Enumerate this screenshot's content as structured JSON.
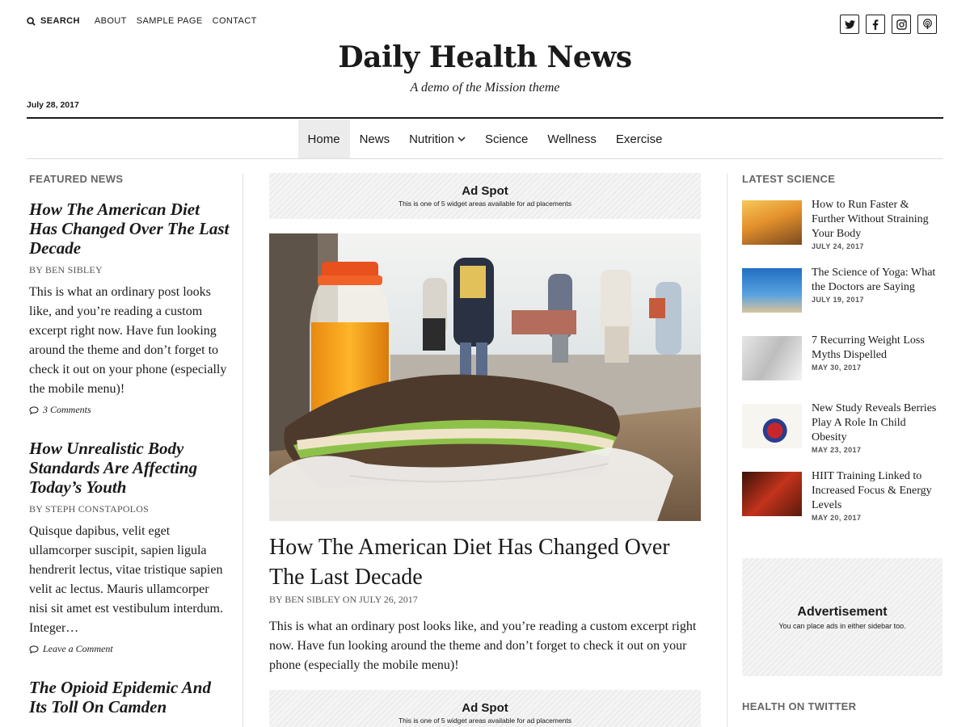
{
  "topbar": {
    "search_label": "SEARCH",
    "links": [
      "ABOUT",
      "SAMPLE PAGE",
      "CONTACT"
    ]
  },
  "social": {
    "twitter": "twitter-icon",
    "facebook": "facebook-icon",
    "instagram": "instagram-icon",
    "podcast": "podcast-icon"
  },
  "header": {
    "title": "Daily Health News",
    "tagline": "A demo of the Mission theme",
    "date": "July 28, 2017"
  },
  "nav": {
    "items": [
      "Home",
      "News",
      "Nutrition",
      "Science",
      "Wellness",
      "Exercise"
    ],
    "active": "Home"
  },
  "featured": {
    "heading": "FEATURED NEWS",
    "posts": [
      {
        "title": "How The American Diet Has Changed Over The Last Decade",
        "byline": "BY BEN SIBLEY",
        "excerpt": "This is what an ordinary post looks like, and you’re reading a custom excerpt right now. Have fun looking around the theme and don’t forget to check it out on your phone (especially the mobile menu)!",
        "comments": "3 Comments"
      },
      {
        "title": "How Unrealistic Body Standards Are Affecting Today’s Youth",
        "byline": "BY STEPH CONSTAPOLOS",
        "excerpt": "Quisque dapibus, velit eget ullamcorper suscipit, sapien ligula hendrerit lectus, vitae tristique sapien velit ac lectus. Mauris ullamcorper nisi sit amet est vestibulum interdum. Integer…",
        "comments": "Leave a Comment"
      },
      {
        "title": "The Opioid Epidemic And Its Toll On Camden"
      }
    ]
  },
  "main": {
    "ad_top": {
      "title": "Ad Spot",
      "subtitle": "This is one of 5 widget areas available for ad placements"
    },
    "post": {
      "title": "How The American Diet Has Changed Over The Last Decade",
      "byline": "BY BEN SIBLEY ON JULY 26, 2017",
      "excerpt": "This is what an ordinary post looks like, and you’re reading a custom excerpt right now. Have fun looking around the theme and don’t forget to check it out on your phone (especially the mobile menu)!"
    },
    "ad_bottom": {
      "title": "Ad Spot",
      "subtitle": "This is one of 5 widget areas available for ad placements"
    }
  },
  "science": {
    "heading": "LATEST SCIENCE",
    "items": [
      {
        "title": "How to Run Faster & Further Without Straining Your Body",
        "date": "JULY 24, 2017",
        "thumb_colors": [
          "#f4b23f",
          "#7a4a1f"
        ]
      },
      {
        "title": "The Science of Yoga: What the Doctors are Saying",
        "date": "JULY 19, 2017",
        "thumb_colors": [
          "#2d7fd0",
          "#d9c39a"
        ]
      },
      {
        "title": "7 Recurring Weight Loss Myths Dispelled",
        "date": "MAY 30, 2017",
        "thumb_colors": [
          "#f0f0f0",
          "#9a9a9a"
        ]
      },
      {
        "title": "New Study Reveals Berries Play A Role In Child Obesity",
        "date": "MAY 23, 2017",
        "thumb_colors": [
          "#f7f5f0",
          "#c9262c"
        ]
      },
      {
        "title": "HIIT Training Linked to Increased Focus & Energy Levels",
        "date": "MAY 20, 2017",
        "thumb_colors": [
          "#c2331c",
          "#3a1208"
        ]
      }
    ]
  },
  "sidebar_ad": {
    "title": "Advertisement",
    "subtitle": "You can place ads in either sidebar too."
  },
  "twitter": {
    "heading": "HEALTH ON TWITTER"
  }
}
